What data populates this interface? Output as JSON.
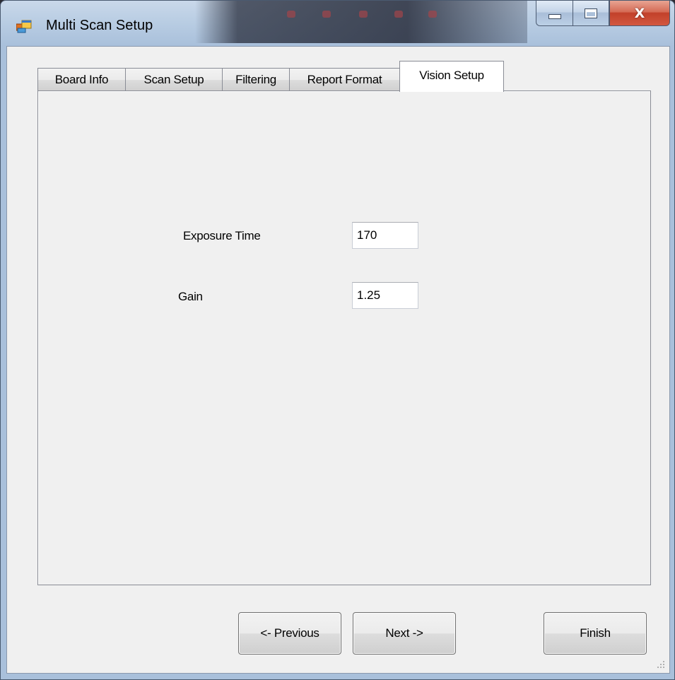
{
  "window": {
    "title": "Multi Scan Setup",
    "close_glyph": "X",
    "icon": "app-window-icon",
    "colors": {
      "close_button": "#c94b32",
      "frame": "#a9c0db",
      "client_bg": "#f0f0f0"
    }
  },
  "tabs": [
    {
      "label": "Board Info",
      "active": false
    },
    {
      "label": "Scan Setup",
      "active": false
    },
    {
      "label": "Filtering",
      "active": false
    },
    {
      "label": "Report Format",
      "active": false
    },
    {
      "label": "Vision Setup",
      "active": true
    }
  ],
  "vision_setup": {
    "exposure_label": "Exposure Time",
    "exposure_value": "170",
    "gain_label": "Gain",
    "gain_value": "1.25"
  },
  "buttons": {
    "previous": "<- Previous",
    "next": "Next ->",
    "finish": "Finish"
  }
}
